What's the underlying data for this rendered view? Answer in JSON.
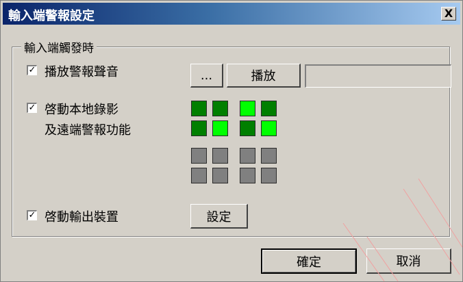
{
  "dialog": {
    "title": "輸入端警報設定",
    "close_label": "X"
  },
  "group": {
    "legend": "輸入端觸發時"
  },
  "options": {
    "play_sound": {
      "label": "播放警報聲音",
      "checked": "✓"
    },
    "record": {
      "label_line1": "啓動本地錄影",
      "label_line2": "及遠端警報功能",
      "checked": "✓"
    },
    "output": {
      "label": "啓動輸出裝置",
      "checked": "✓"
    }
  },
  "buttons": {
    "browse": "...",
    "play": "播放",
    "settings": "設定",
    "ok": "確定",
    "cancel": "取消"
  },
  "sound_file": {
    "value": ""
  },
  "camera_grid_top": [
    "on-dark",
    "on-dark",
    "on-bright",
    "on-dark",
    "on-dark",
    "on-bright",
    "on-dark",
    "on-bright"
  ],
  "camera_grid_bottom": [
    "off",
    "off",
    "off",
    "off",
    "off",
    "off",
    "off",
    "off"
  ],
  "colors": {
    "camera_selected": "#007f00",
    "camera_active": "#00ff00",
    "camera_disabled": "#808080",
    "title_gradient_start": "#0a246a"
  }
}
